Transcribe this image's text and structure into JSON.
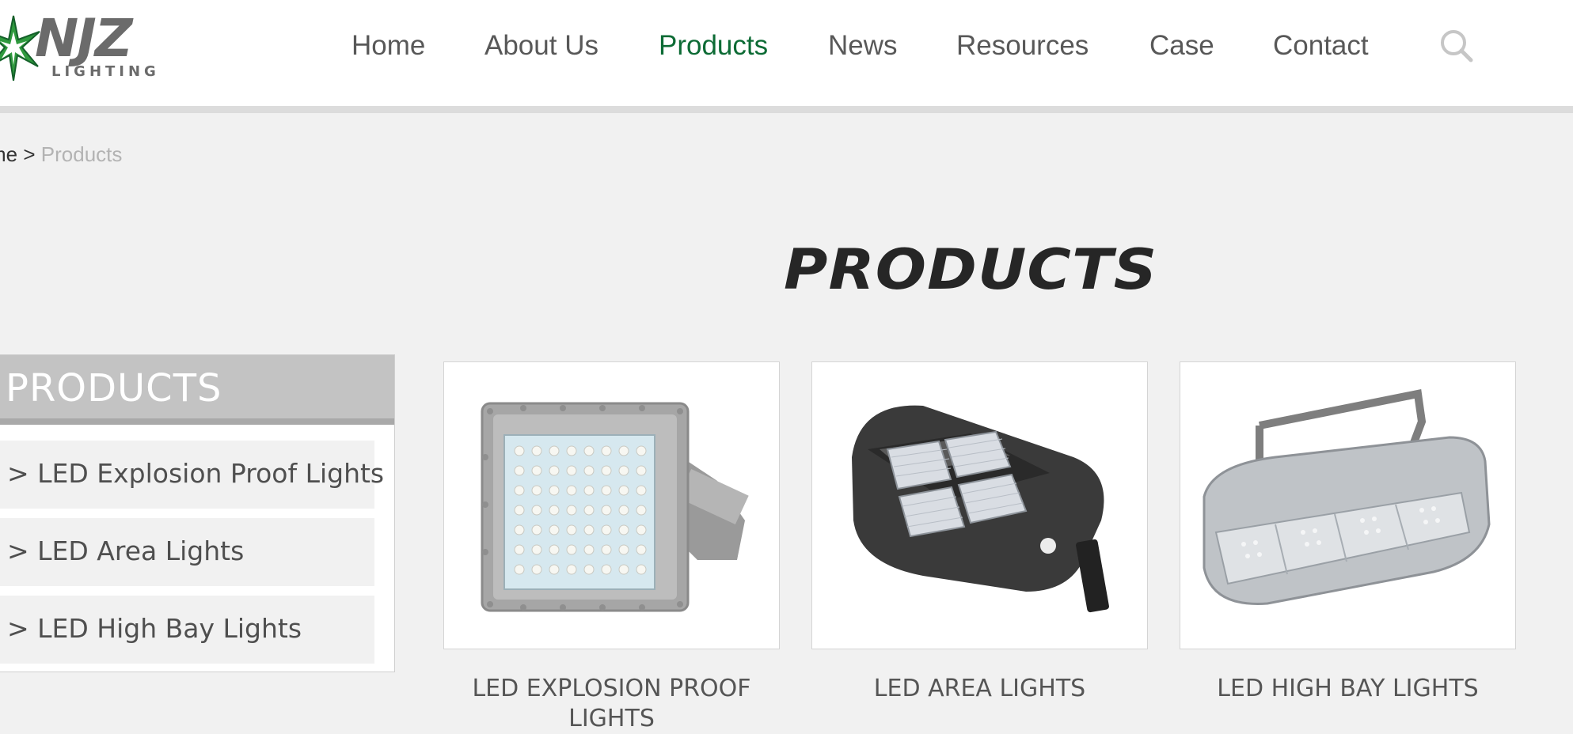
{
  "logo": {
    "name": "NJZ",
    "sub": "LIGHTING"
  },
  "nav": {
    "items": [
      {
        "label": "Home"
      },
      {
        "label": "About Us"
      },
      {
        "label": "Products"
      },
      {
        "label": "News"
      },
      {
        "label": "Resources"
      },
      {
        "label": "Case"
      },
      {
        "label": "Contact"
      }
    ],
    "active": "Products",
    "search_icon": "search-icon"
  },
  "breadcrumb": {
    "home": "me",
    "separator": ">",
    "current": "Products"
  },
  "page_title": "PRODUCTS",
  "sidebar": {
    "title": "PRODUCTS",
    "items": [
      {
        "label": "> LED Explosion Proof Lights"
      },
      {
        "label": "> LED Area Lights"
      },
      {
        "label": "> LED High Bay Lights"
      }
    ]
  },
  "products": [
    {
      "caption": "LED EXPLOSION PROOF LIGHTS",
      "image": "explosion-proof-light-image"
    },
    {
      "caption": "LED AREA LIGHTS",
      "image": "area-light-image"
    },
    {
      "caption": "LED HIGH BAY LIGHTS",
      "image": "high-bay-light-image"
    }
  ],
  "colors": {
    "accent": "#0d6b35",
    "star_green": "#3aa642",
    "title": "#262626"
  }
}
